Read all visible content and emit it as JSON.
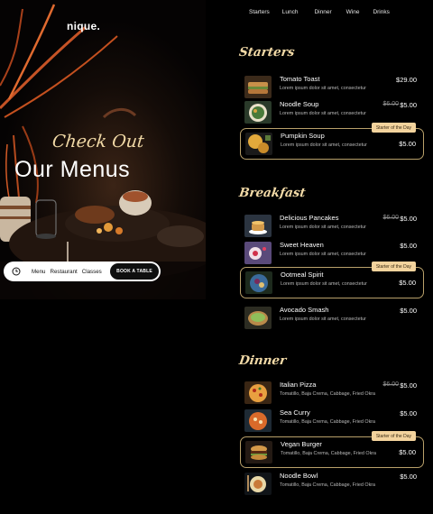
{
  "hero": {
    "logo": "nique.",
    "eyebrow": "Check Out",
    "headline": "Our Menus"
  },
  "navbar": {
    "links": [
      "Menu",
      "Restaurant",
      "Classes"
    ],
    "cta": "BOOK A TABLE"
  },
  "topnav": [
    "Starters",
    "Lunch",
    "Dinner",
    "Wine",
    "Drinks"
  ],
  "sections": [
    {
      "title": "Starters",
      "items": [
        {
          "name": "Tomato Toast",
          "desc": "Lorem ipsum dolor sit amet, consectetur",
          "price": "$29.00",
          "old_price": "",
          "badge": "",
          "image": "toast"
        },
        {
          "name": "Noodle Soup",
          "desc": "Lorem ipsum dolor sit amet, consectetur",
          "price": "$5.00",
          "old_price": "$6.00",
          "badge": "",
          "image": "noodle-soup"
        },
        {
          "name": "Pumpkin Soup",
          "desc": "Lorem ipsum dolor sit amet, consectetur",
          "price": "$5.00",
          "old_price": "",
          "badge": "Starter of the Day",
          "image": "pumpkin-soup"
        }
      ]
    },
    {
      "title": "Breakfast",
      "items": [
        {
          "name": "Delicious Pancakes",
          "desc": "Lorem ipsum dolor sit amet, consectetur",
          "price": "$5.00",
          "old_price": "$6.00",
          "badge": "",
          "image": "pancakes"
        },
        {
          "name": "Sweet Heaven",
          "desc": "Lorem ipsum dolor sit amet, consectetur",
          "price": "$5.00",
          "old_price": "",
          "badge": "",
          "image": "sweet"
        },
        {
          "name": "Ootmeal Spirit",
          "desc": "Lorem ipsum dolor sit amet, consectetur",
          "price": "$5.00",
          "old_price": "",
          "badge": "Starter of the Day",
          "image": "oatmeal"
        },
        {
          "name": "Avocado Smash",
          "desc": "Lorem ipsum dolor sit amet, consectetur",
          "price": "$5.00",
          "old_price": "",
          "badge": "",
          "image": "avocado"
        }
      ]
    },
    {
      "title": "Dinner",
      "items": [
        {
          "name": "Italian Pizza",
          "desc": "Tomatillo, Baja Crema, Cabbage, Fried Okra",
          "price": "$5.00",
          "old_price": "$6.00",
          "badge": "",
          "image": "pizza"
        },
        {
          "name": "Sea Curry",
          "desc": "Tomatillo, Baja Crema, Cabbage, Fried Okra",
          "price": "$5.00",
          "old_price": "",
          "badge": "",
          "image": "curry"
        },
        {
          "name": "Vegan Burger",
          "desc": "Tomatillo, Baja Crema, Cabbage, Fried Okra",
          "price": "$5.00",
          "old_price": "",
          "badge": "Starter of the Day",
          "image": "burger"
        },
        {
          "name": "Noodle Bowl",
          "desc": "Tomatillo, Baja Crema, Cabbage, Fried Okra",
          "price": "$5.00",
          "old_price": "",
          "badge": "",
          "image": "noodle-bowl"
        }
      ]
    }
  ],
  "colors": {
    "accent_gold": "#f1d9a6",
    "badge_bg": "#f3d39d",
    "featured_border": "#b8a06a",
    "background": "#000000"
  }
}
